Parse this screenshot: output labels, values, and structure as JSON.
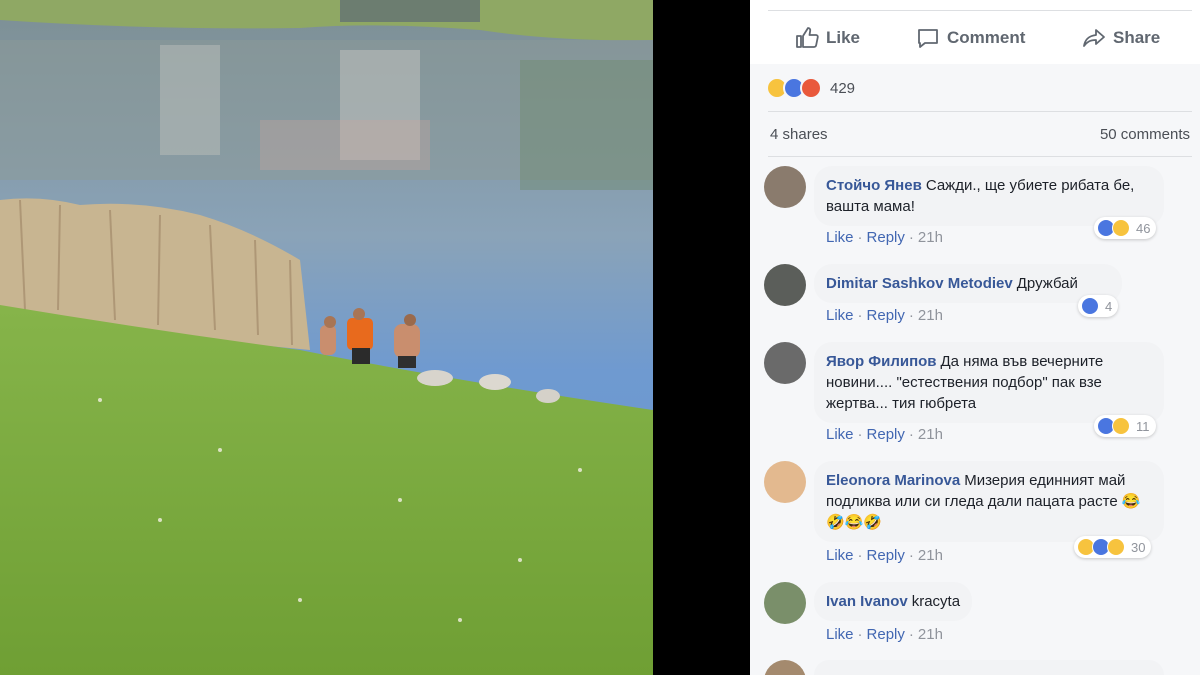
{
  "actions": {
    "like": "Like",
    "comment": "Comment",
    "share": "Share"
  },
  "reactions": {
    "count": "429"
  },
  "stats": {
    "shares": "4 shares",
    "comments": "50 comments"
  },
  "comments": [
    {
      "author": "Стойчо Янев",
      "text": "Сажди., ще убиете рибата бе, вашта мама!",
      "like": "Like",
      "reply": "Reply",
      "time": "21h",
      "reactions": "46"
    },
    {
      "author": "Dimitar Sashkov Metodiev",
      "text": "Дружбай",
      "like": "Like",
      "reply": "Reply",
      "time": "21h",
      "reactions": "4"
    },
    {
      "author": "Явор Филипов",
      "text": "Да няма във вечерните новини.... \"естествения подбор\" пак взе жертва... тия гюбрета",
      "like": "Like",
      "reply": "Reply",
      "time": "21h",
      "reactions": "11"
    },
    {
      "author": "Eleonora Marinova",
      "text": "Мизерия единният май подликва или си гледа дали пацата расте 😂🤣😂🤣",
      "like": "Like",
      "reply": "Reply",
      "time": "21h",
      "reactions": "30"
    },
    {
      "author": "Ivan Ivanov",
      "text": "kracyta",
      "like": "Like",
      "reply": "Reply",
      "time": "21h"
    }
  ],
  "colors": {
    "link": "#385898",
    "accent": "#4267b2",
    "grass": "#7fae3e",
    "lake": "#5e8fc8"
  }
}
